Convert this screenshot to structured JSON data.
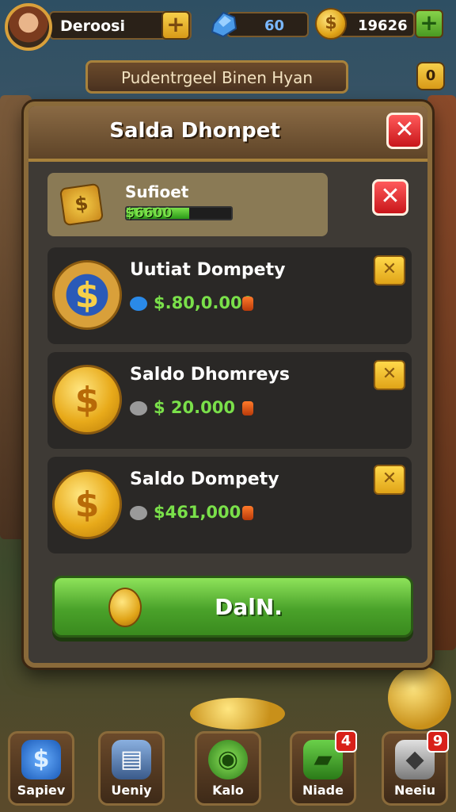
{
  "player": {
    "name": "Deroosi"
  },
  "resources": {
    "gems": "60",
    "coins": "19626"
  },
  "banner": {
    "text": "Pudentrgeel Binen Hyan",
    "badge": "0"
  },
  "dialog": {
    "title": "Salda Dhonpet",
    "close_glyph": "✕",
    "summary": {
      "title": "Sufioet",
      "amount": "$6600",
      "progress": 0.6
    },
    "rows": [
      {
        "title": "Uutiat Dompety",
        "amount": "$.80,0.000",
        "coin": "blue"
      },
      {
        "title": "Saldo Dhomreys",
        "amount": "$ 20.000",
        "coin": "gold"
      },
      {
        "title": "Saldo Dompety",
        "amount": "$461,000",
        "coin": "gold"
      }
    ],
    "cta_label": "DalN."
  },
  "nav": [
    {
      "label": "Sapiev",
      "badge": ""
    },
    {
      "label": "Ueniy",
      "badge": ""
    },
    {
      "label": "Kalo",
      "badge": ""
    },
    {
      "label": "Niade",
      "badge": "4"
    },
    {
      "label": "Neeiu",
      "badge": "9"
    }
  ],
  "colors": {
    "accent_green": "#7ae04a",
    "close_red": "#d8201a",
    "gold": "#e0a418"
  }
}
